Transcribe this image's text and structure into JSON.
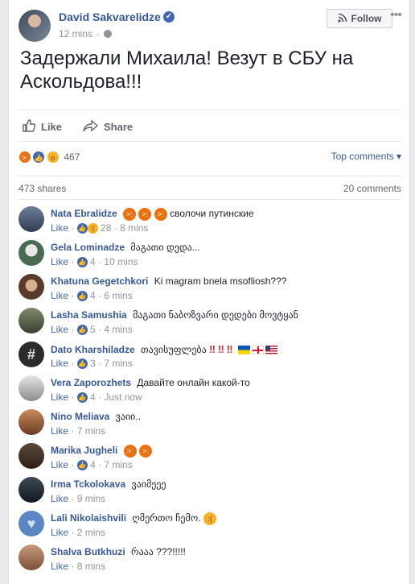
{
  "post": {
    "author": "David Sakvarelidze",
    "time": "12 mins",
    "follow_label": "Follow",
    "text": "Задержали Михаила! Везут в СБУ на Аскольдова!!!",
    "actions": {
      "like": "Like",
      "share": "Share"
    },
    "reactions_count": "467",
    "top_comments_label": "Top comments",
    "shares_label": "473 shares",
    "comments_label": "20 comments"
  },
  "colors": {
    "link": "#365899",
    "accent": "#4267b2",
    "muted": "#90949c"
  },
  "comments": [
    {
      "name": "Nata Ebralidze",
      "text": "сволочи путинские",
      "like": "Like",
      "reacts": "28",
      "time": "8 mins"
    },
    {
      "name": "Gela Lominadze",
      "text": "მაგათი დედა...",
      "like": "Like",
      "reacts": "4",
      "time": "10 mins"
    },
    {
      "name": "Khatuna Gegetchkori",
      "text": "Ki magram bnela msofliosh???",
      "like": "Like",
      "reacts": "4",
      "time": "6 mins"
    },
    {
      "name": "Lasha Samushia",
      "text": "მაგათი ნაბოზვარი დედები მოვტყან",
      "like": "Like",
      "reacts": "5",
      "time": "4 mins"
    },
    {
      "name": "Dato Kharshiladze",
      "text": "თავისუფლება",
      "like": "Like",
      "reacts": "3",
      "time": "7 mins"
    },
    {
      "name": "Vera Zaporozhets",
      "text": "Давайте онлайн какой-то",
      "like": "Like",
      "reacts": "4",
      "time": "Just now"
    },
    {
      "name": "Nino Meliava",
      "text": "ვაიი..",
      "like": "Like",
      "time": "7 mins"
    },
    {
      "name": "Marika Jugheli",
      "text": "",
      "like": "Like",
      "reacts": "4",
      "time": "7 mins"
    },
    {
      "name": "Irma Tckolokava",
      "text": "ვაიმეეე",
      "like": "Like",
      "time": "9 mins"
    },
    {
      "name": "Lali Nikolaishvili",
      "text": "ღმერთო ჩემო.",
      "like": "Like",
      "time": "2 mins"
    },
    {
      "name": "Shalva Butkhuzi",
      "text": "რააა ???!!!!!",
      "like": "Like",
      "time": "8 mins"
    }
  ]
}
